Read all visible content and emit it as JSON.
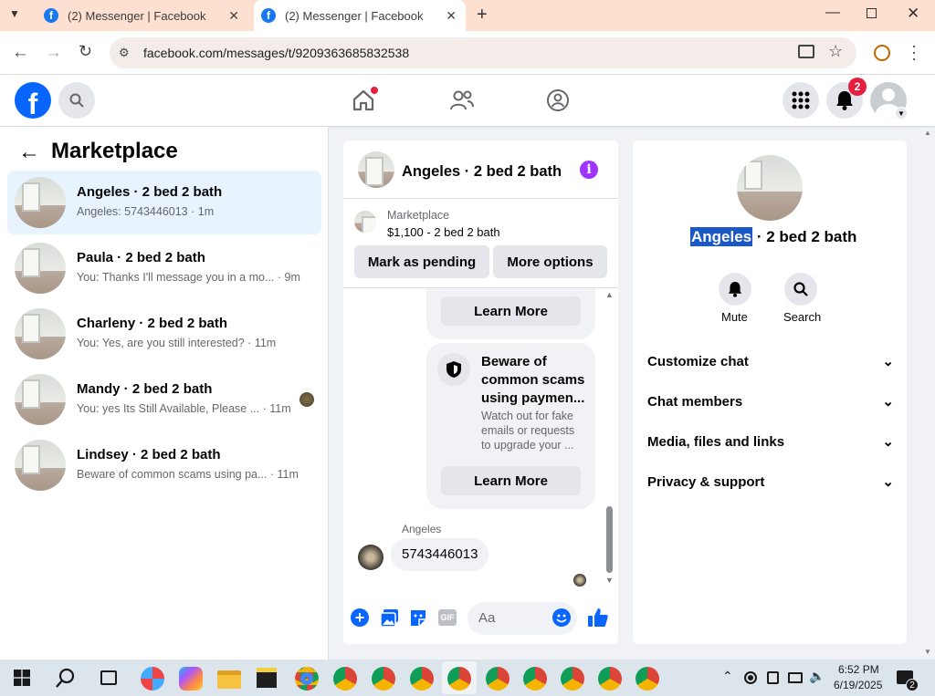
{
  "browser": {
    "tabs": [
      {
        "title": "(2) Messenger | Facebook",
        "active": false
      },
      {
        "title": "(2) Messenger | Facebook",
        "active": true
      }
    ],
    "url": "facebook.com/messages/t/9209363685832538"
  },
  "fb": {
    "notifications_count": "2"
  },
  "left": {
    "title": "Marketplace",
    "threads": [
      {
        "title": "Angeles · 2 bed 2 bath",
        "preview": "Angeles: 5743446013 · 1m",
        "active": true
      },
      {
        "title": "Paula · 2 bed 2 bath",
        "preview": "You: Thanks I'll message you in a mo... · 9m",
        "active": false
      },
      {
        "title": "Charleny · 2 bed 2 bath",
        "preview": "You: Yes, are you still interested? · 11m",
        "active": false
      },
      {
        "title": "Mandy · 2 bed 2 bath",
        "preview": "You: yes Its Still Available, Please ... · 11m",
        "active": false
      },
      {
        "title": "Lindsey · 2 bed 2 bath",
        "preview": "Beware of common scams using pa... · 11m",
        "active": false
      }
    ]
  },
  "chat": {
    "title": "Angeles · 2 bed 2 bath",
    "listing_source": "Marketplace",
    "listing_price": "$1,100 - 2 bed 2 bath",
    "mark_pending": "Mark as pending",
    "more_options": "More options",
    "learn_more_1": "Learn More",
    "scam_title": "Beware of common scams using paymen...",
    "scam_body": "Watch out for fake emails or requests to upgrade your ...",
    "learn_more_2": "Learn More",
    "sender": "Angeles",
    "message": "5743446013",
    "composer_placeholder": "Aa",
    "composer_gif": "GIF"
  },
  "right": {
    "name_highlight": "Angeles",
    "name_rest": " · 2 bed 2 bath",
    "mute": "Mute",
    "search": "Search",
    "sections": [
      "Customize chat",
      "Chat members",
      "Media, files and links",
      "Privacy & support"
    ]
  },
  "taskbar": {
    "time": "6:52 PM",
    "date": "6/19/2025",
    "chat_badge": "2"
  }
}
